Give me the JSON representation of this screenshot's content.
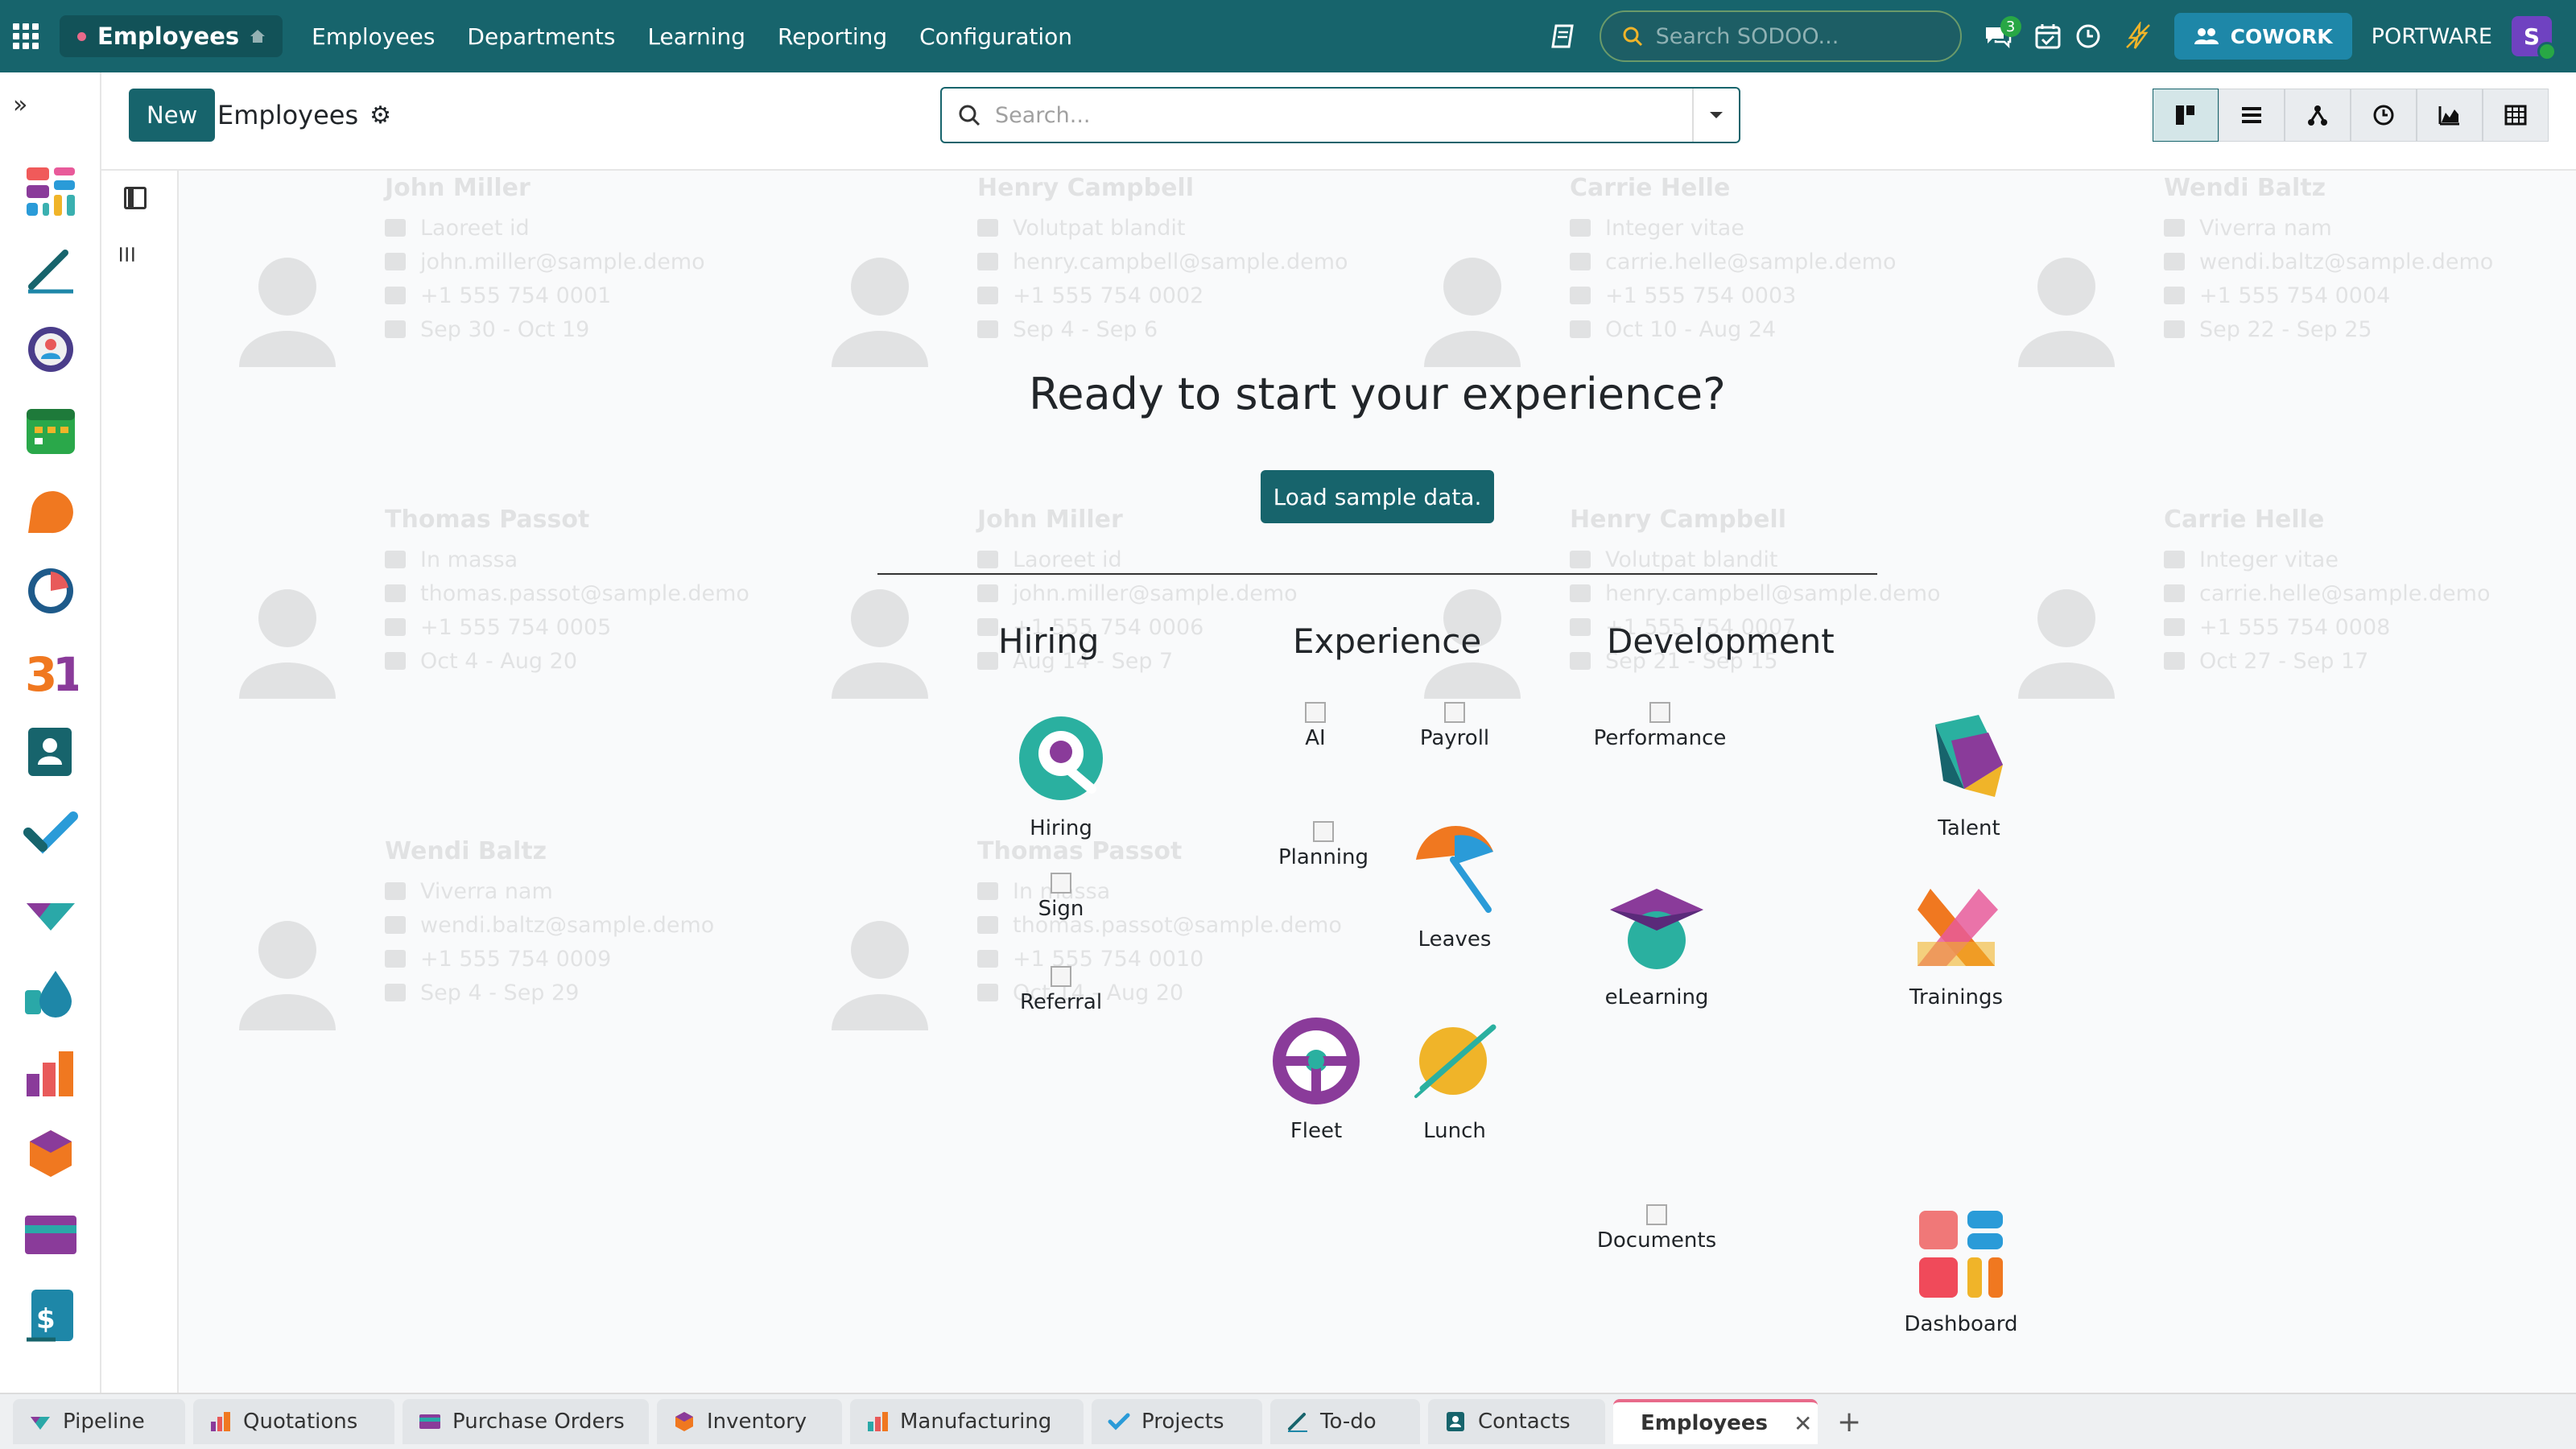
{
  "navbar": {
    "app_name": "Employees",
    "menu": [
      "Employees",
      "Departments",
      "Learning",
      "Reporting",
      "Configuration"
    ],
    "search_placeholder": "Search SODOO...",
    "messages_badge": "3",
    "cowork_label": "COWORK",
    "company": "PORTWARE",
    "avatar_initial": "S"
  },
  "control": {
    "new_label": "New",
    "title": "Employees",
    "search_placeholder": "Search..."
  },
  "helper": {
    "title": "Ready to start your experience?",
    "load_label": "Load sample data.",
    "columns": [
      "Hiring",
      "Experience",
      "Development"
    ],
    "apps": {
      "hiring": "Hiring",
      "sign": "Sign",
      "referral": "Referral",
      "ai": "AI",
      "payroll": "Payroll",
      "planning": "Planning",
      "leaves": "Leaves",
      "fleet": "Fleet",
      "lunch": "Lunch",
      "performance": "Performance",
      "talent": "Talent",
      "elearning": "eLearning",
      "trainings": "Trainings",
      "documents": "Documents",
      "dashboard": "Dashboard"
    }
  },
  "sample_cards": [
    {
      "name": "John Miller",
      "job": "Laoreet id",
      "email": "john.miller@sample.demo",
      "phone": "+1 555 754 0001",
      "dates": "Sep 30 - Oct 19"
    },
    {
      "name": "Henry Campbell",
      "job": "Volutpat blandit",
      "email": "henry.campbell@sample.demo",
      "phone": "+1 555 754 0002",
      "dates": "Sep 4 - Sep 6"
    },
    {
      "name": "Carrie Helle",
      "job": "Integer vitae",
      "email": "carrie.helle@sample.demo",
      "phone": "+1 555 754 0003",
      "dates": "Oct 10 - Aug 24"
    },
    {
      "name": "Wendi Baltz",
      "job": "Viverra nam",
      "email": "wendi.baltz@sample.demo",
      "phone": "+1 555 754 0004",
      "dates": "Sep 22 - Sep 25"
    },
    {
      "name": "Thomas Passot",
      "job": "In massa",
      "email": "thomas.passot@sample.demo",
      "phone": "+1 555 754 0005",
      "dates": "Oct 4 - Aug 20"
    },
    {
      "name": "John Miller",
      "job": "Laoreet id",
      "email": "john.miller@sample.demo",
      "phone": "+1 555 754 0006",
      "dates": "Aug 14 - Sep 7"
    },
    {
      "name": "Henry Campbell",
      "job": "Volutpat blandit",
      "email": "henry.campbell@sample.demo",
      "phone": "+1 555 754 0007",
      "dates": "Sep 21 - Sep 15"
    },
    {
      "name": "Carrie Helle",
      "job": "Integer vitae",
      "email": "carrie.helle@sample.demo",
      "phone": "+1 555 754 0008",
      "dates": "Oct 27 - Sep 17"
    },
    {
      "name": "Wendi Baltz",
      "job": "Viverra nam",
      "email": "wendi.baltz@sample.demo",
      "phone": "+1 555 754 0009",
      "dates": "Sep 4 - Sep 29"
    },
    {
      "name": "Thomas Passot",
      "job": "In massa",
      "email": "thomas.passot@sample.demo",
      "phone": "+1 555 754 0010",
      "dates": "Oct 14 - Aug 20"
    }
  ],
  "bottom_tabs": [
    "Pipeline",
    "Quotations",
    "Purchase Orders",
    "Inventory",
    "Manufacturing",
    "Projects",
    "To-do",
    "Contacts",
    "Employees"
  ],
  "colors": {
    "brand": "#17646c",
    "accent": "#e86a8a",
    "badge": "#28a745"
  }
}
